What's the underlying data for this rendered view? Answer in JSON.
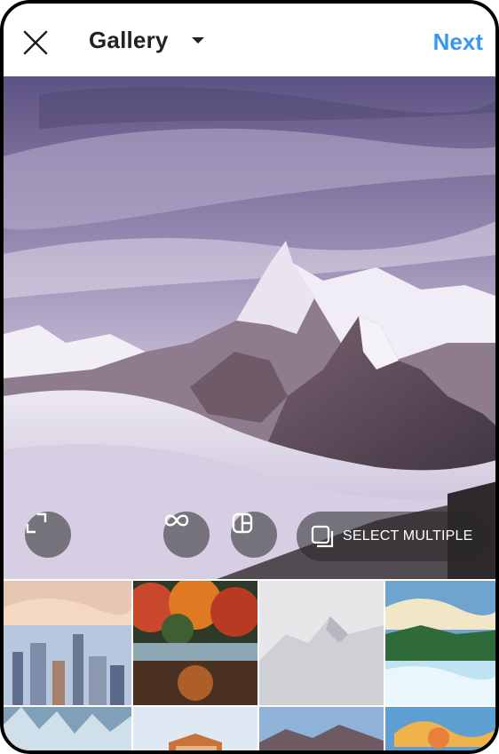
{
  "header": {
    "close_icon": "close-icon",
    "title": "Gallery",
    "dropdown_icon": "caret-down-icon",
    "next_label": "Next",
    "accent_color": "#3897f0"
  },
  "preview": {
    "expand_icon": "expand-icon",
    "boomerang_icon": "infinity-icon",
    "layout_icon": "layout-icon",
    "select_multiple": {
      "icon": "stack-icon",
      "label": "SELECT MULTIPLE"
    }
  },
  "gallery": {
    "thumbnails": [
      {
        "subject": "city-skyline"
      },
      {
        "subject": "autumn-lake"
      },
      {
        "subject": "misty-mountains"
      },
      {
        "subject": "river-landscape"
      },
      {
        "subject": "snowy-forest"
      },
      {
        "subject": "house"
      },
      {
        "subject": "mountain-range"
      },
      {
        "subject": "sunset-clouds"
      }
    ]
  }
}
